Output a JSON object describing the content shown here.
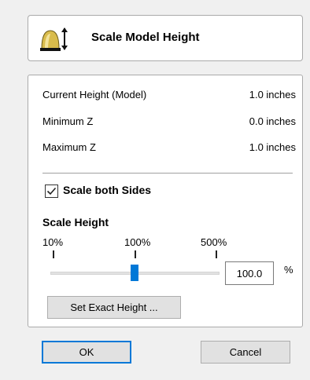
{
  "header": {
    "title": "Scale Model Height",
    "icon": "scale-model-icon"
  },
  "info": [
    {
      "label": "Current Height (Model)",
      "value": "1.0 inches"
    },
    {
      "label": "Minimum Z",
      "value": "0.0 inches"
    },
    {
      "label": "Maximum Z",
      "value": "1.0 inches"
    }
  ],
  "options": {
    "scale_both_sides_label": "Scale both Sides",
    "scale_both_sides_checked": true
  },
  "scale": {
    "section_title": "Scale Height",
    "tick_labels": [
      "10%",
      "100%",
      "500%"
    ],
    "value": "100.0",
    "unit": "%",
    "set_exact_label": "Set Exact Height ..."
  },
  "footer": {
    "ok_label": "OK",
    "cancel_label": "Cancel"
  },
  "colors": {
    "accent": "#0078d7",
    "icon_gold": "#d4b84a"
  }
}
